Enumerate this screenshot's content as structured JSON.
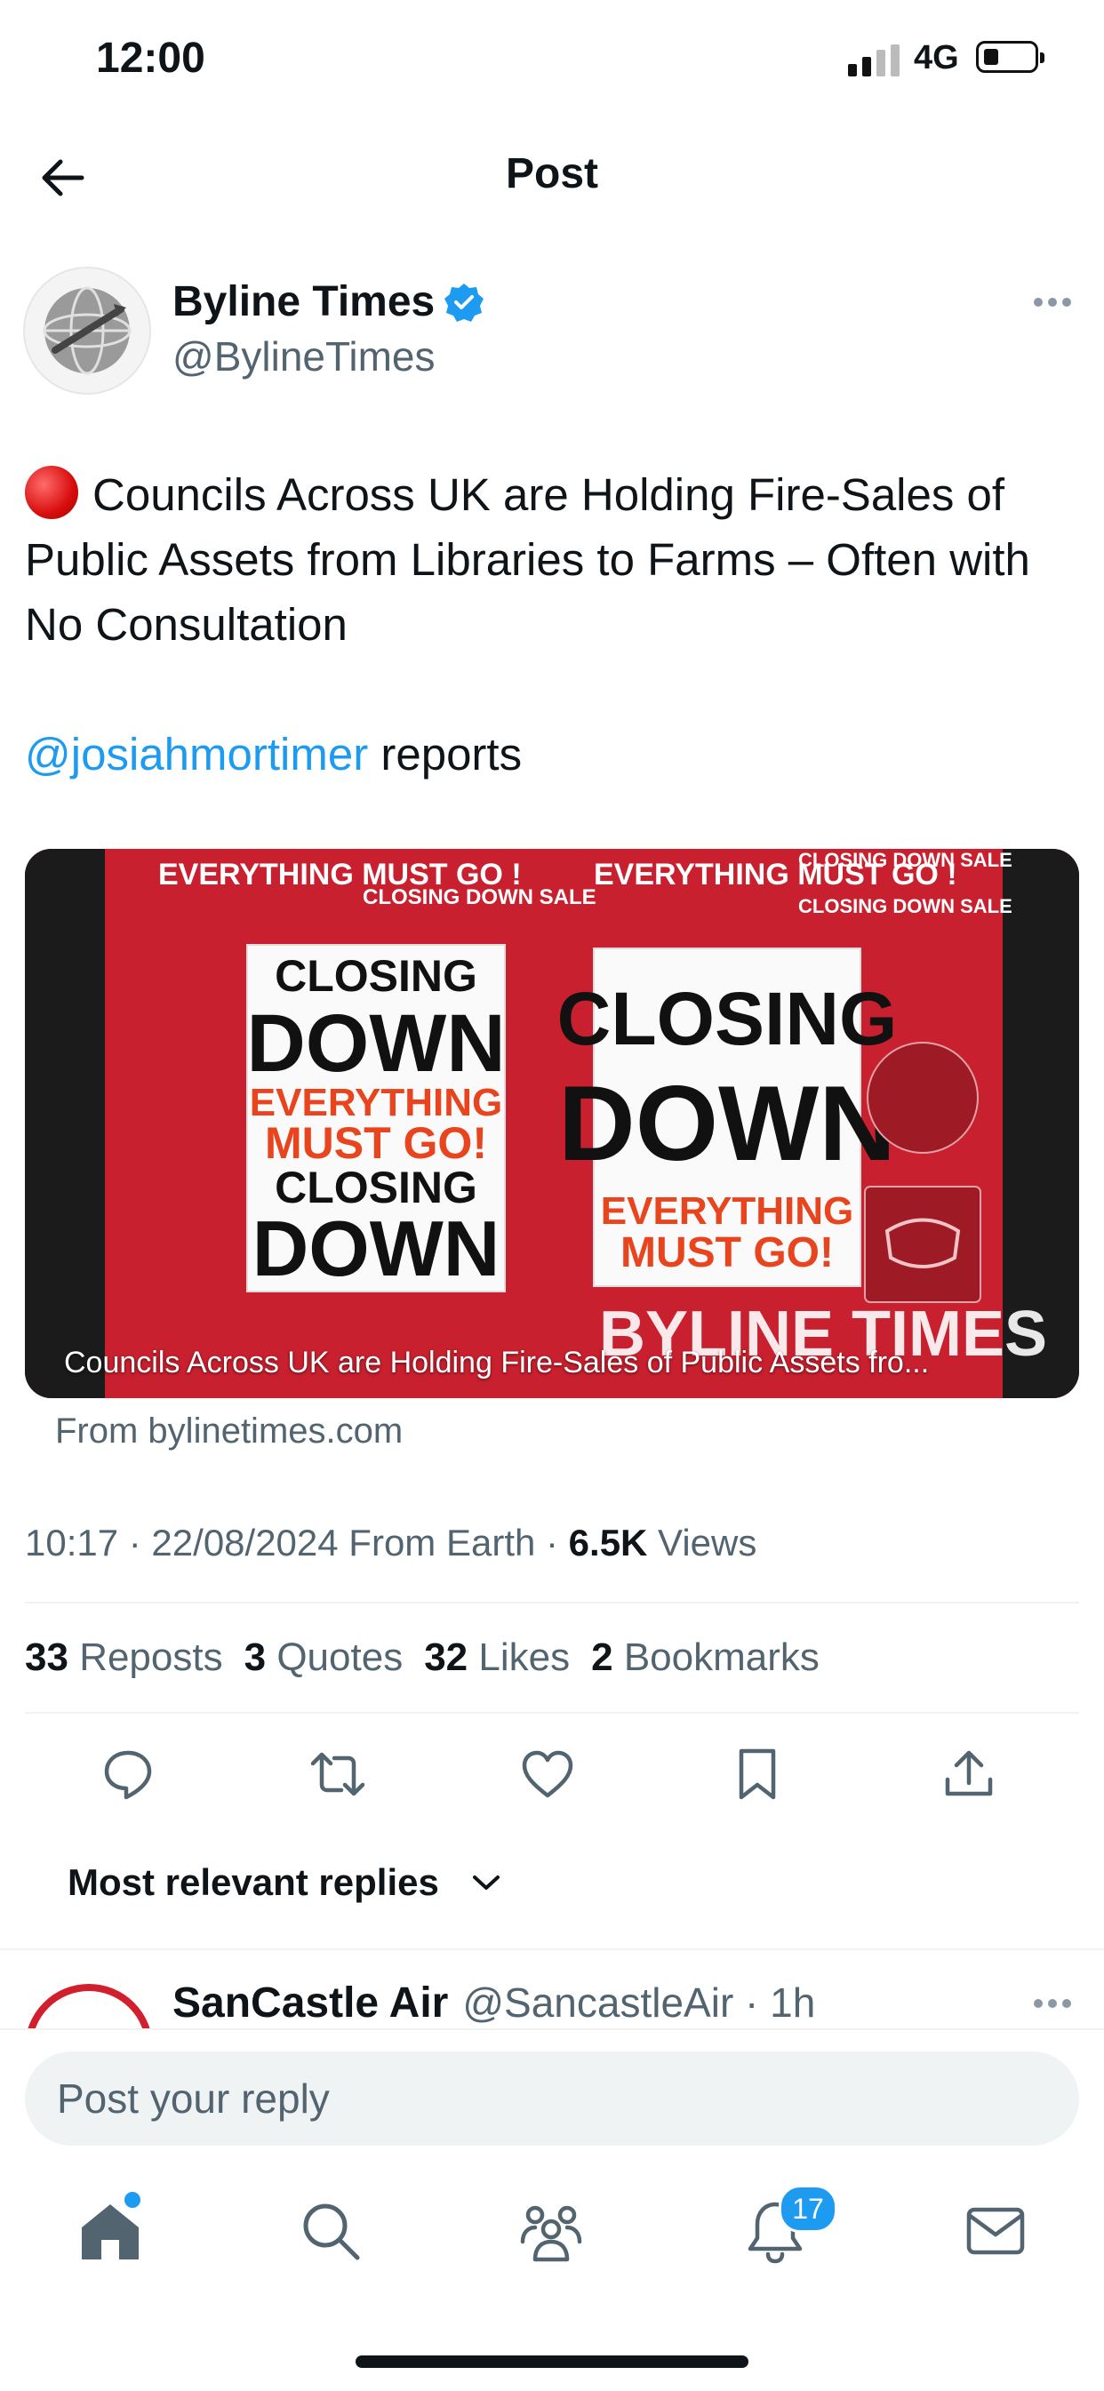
{
  "status_bar": {
    "time": "12:00",
    "network": "4G"
  },
  "header": {
    "title": "Post"
  },
  "author": {
    "name": "Byline Times",
    "handle": "@BylineTimes"
  },
  "tweet": {
    "headline": "Councils Across UK are Holding Fire-Sales of Public Assets from Libraries to Farms – Often with No Consultation",
    "mention": "@josiahmortimer",
    "mention_suffix": " reports"
  },
  "card": {
    "caption": "Councils Across UK are Holding Fire-Sales of Public Assets fro...",
    "source": "From bylinetimes.com",
    "image_text": {
      "big_sign_1": "CLOSING",
      "big_sign_2": "DOWN",
      "must_go_1": "EVERYTHING",
      "must_go_2": "MUST GO!",
      "small_banner": "EVERYTHING MUST GO !",
      "small_banner_2": "CLOSING DOWN SALE",
      "watermark": "BYLINE TIMES"
    }
  },
  "meta": {
    "time_date": "10:17 · 22/08/2024 From Earth · ",
    "views_count": "6.5K",
    "views_label": " Views"
  },
  "stats": [
    {
      "count": "33",
      "label": "Reposts"
    },
    {
      "count": "3",
      "label": "Quotes"
    },
    {
      "count": "32",
      "label": "Likes"
    },
    {
      "count": "2",
      "label": "Bookmarks"
    }
  ],
  "replies_filter": {
    "label": "Most relevant replies"
  },
  "reply": {
    "name": "SanCastle Air",
    "handle": "@SancastleAir · 1h"
  },
  "composer": {
    "placeholder": "Post your reply"
  },
  "nav": {
    "notification_count": "17"
  },
  "colors": {
    "accent": "#1d9bf0",
    "text": "#0f1419",
    "muted": "#536471"
  }
}
